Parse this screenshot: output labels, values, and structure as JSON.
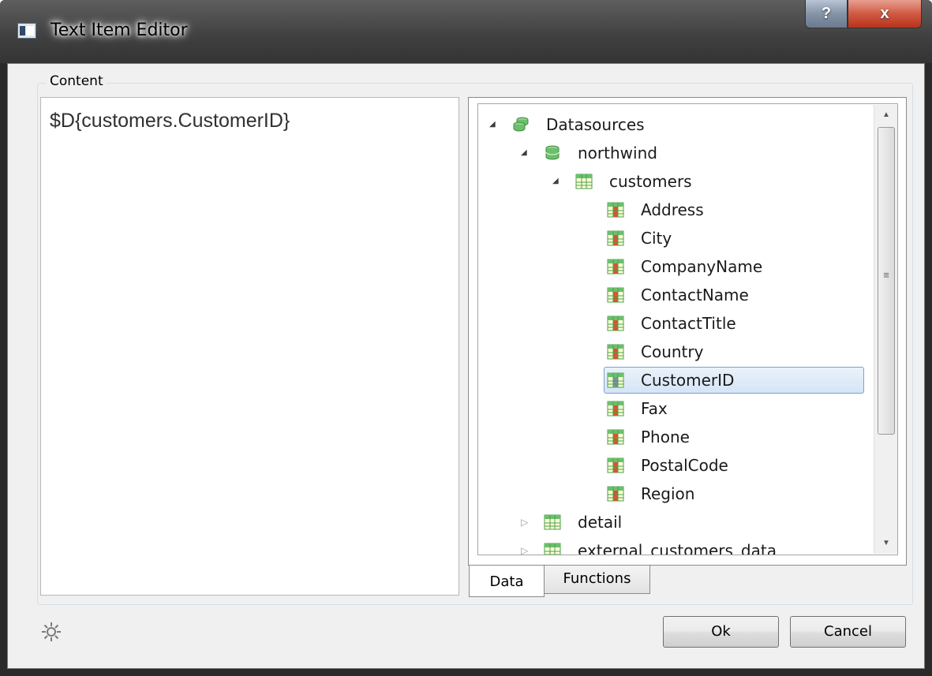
{
  "window": {
    "title": "Text Item Editor",
    "help_label": "?",
    "close_label": "x"
  },
  "content": {
    "group_label": "Content",
    "text": "$D{customers.CustomerID}"
  },
  "tree": {
    "root": "Datasources",
    "datasource": "northwind",
    "table": "customers",
    "fields": [
      "Address",
      "City",
      "CompanyName",
      "ContactName",
      "ContactTitle",
      "Country",
      "CustomerID",
      "Fax",
      "Phone",
      "PostalCode",
      "Region"
    ],
    "selected_field": "CustomerID",
    "other_tables": [
      "detail",
      "external_customers_data"
    ]
  },
  "tabs": {
    "data": "Data",
    "functions": "Functions",
    "active": "Data"
  },
  "buttons": {
    "ok": "Ok",
    "cancel": "Cancel"
  },
  "icons": {
    "window": "window-icon",
    "settings": "gear-icon",
    "datasources": "datasources-icon",
    "database": "database-icon",
    "table": "table-icon",
    "field": "field-icon"
  }
}
